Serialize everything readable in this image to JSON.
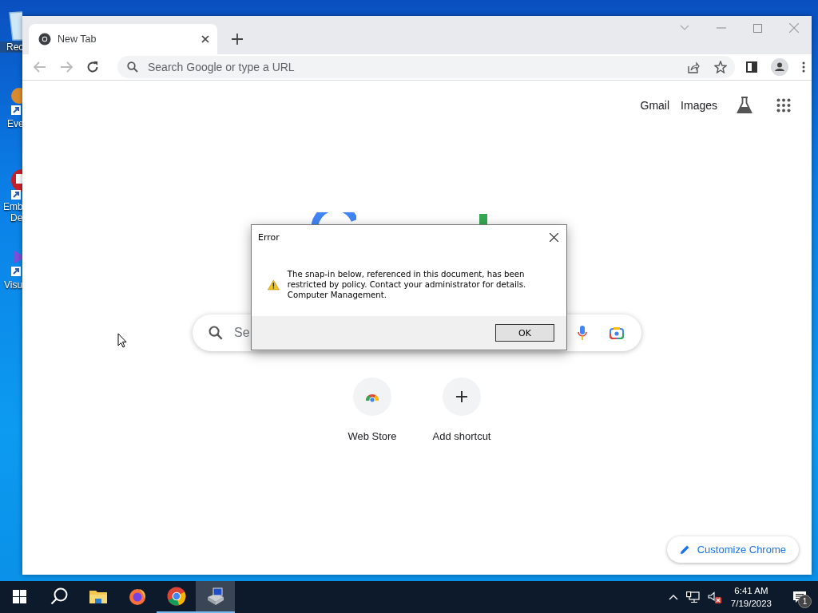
{
  "desktop_icons": [
    {
      "lines": [
        "Rec"
      ],
      "kind": "bin"
    },
    {
      "lines": [
        "Eve"
      ],
      "kind": "viewer"
    },
    {
      "lines": [
        "Emb",
        "De"
      ],
      "kind": "red"
    },
    {
      "lines": [
        "Visu"
      ],
      "kind": "purple"
    }
  ],
  "browser": {
    "tabs": [
      {
        "title": "New Tab",
        "selected": true
      }
    ],
    "address_bar": {
      "placeholder": "Search Google or type a URL"
    },
    "top_links": [
      "Gmail",
      "Images"
    ],
    "search": {
      "placeholder": "Se"
    },
    "shortcuts": [
      {
        "label": "Web Store",
        "kind": "store"
      },
      {
        "label": "Add shortcut",
        "kind": "add"
      }
    ],
    "customize_button": "Customize Chrome"
  },
  "dialog": {
    "title": "Error",
    "message": "The snap-in below, referenced in this document, has been restricted by policy. Contact your administrator for details. Computer Management.",
    "button": "OK"
  },
  "taskbar": {
    "apps": [
      {
        "kind": "start",
        "running": false,
        "selected": false
      },
      {
        "kind": "search",
        "running": false,
        "selected": false
      },
      {
        "kind": "explorer",
        "running": false,
        "selected": false
      },
      {
        "kind": "firefox",
        "running": false,
        "selected": false
      },
      {
        "kind": "chrome",
        "running": true,
        "selected": false
      },
      {
        "kind": "mmc",
        "running": true,
        "selected": true
      }
    ],
    "time": "6:41 AM",
    "date": "7/19/2023",
    "notification_count": "1"
  }
}
